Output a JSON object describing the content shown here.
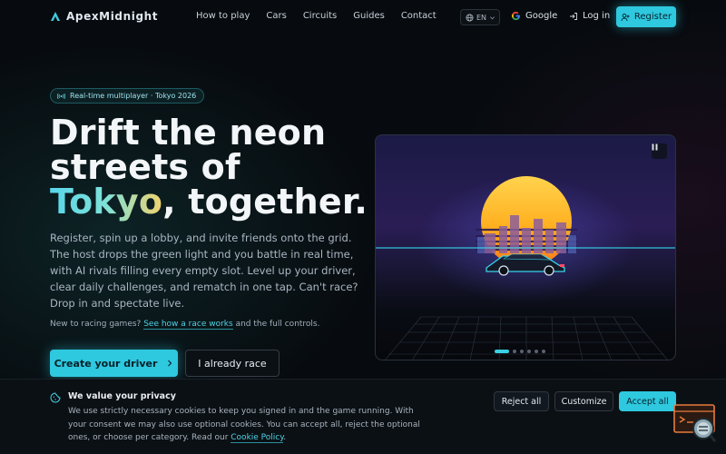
{
  "header": {
    "logo": "ApexMidnight",
    "nav": [
      "How to play",
      "Cars",
      "Circuits",
      "Guides",
      "Contact"
    ],
    "language": "EN",
    "google_label": "Google",
    "login_label": "Log in",
    "register_label": "Register"
  },
  "hero": {
    "badge": "Real-time multiplayer · Tokyo 2026",
    "title_line1": "Drift the neon",
    "title_line2": "streets of",
    "title_highlight": "Tokyo",
    "title_rest": ", together.",
    "lead": "Register, spin up a lobby, and invite friends onto the grid. The host drops the green light and you battle in real time, with AI rivals filling every empty slot. Level up your driver, clear daily challenges, and rematch in one tap. Can't race? Drop in and spectate live.",
    "hint_prefix": "New to racing games?",
    "hint_link": "See how a race works",
    "hint_suffix": "and the full controls.",
    "primary_cta": "Create your driver",
    "secondary_cta": "I already race"
  },
  "carousel": {
    "slide_count": 6,
    "active_index": 0
  },
  "cookie": {
    "title": "We value your privacy",
    "text": "We use strictly necessary cookies to keep you signed in and the game running. With your consent we may also use optional cookies. You can accept all, reject the optional ones, or choose per category. Read our",
    "link": "Cookie Policy",
    "text_end": ".",
    "reject": "Reject all",
    "customize": "Customize",
    "accept": "Accept all"
  },
  "colors": {
    "accent": "#2ec8df",
    "background": "#070b0f"
  }
}
